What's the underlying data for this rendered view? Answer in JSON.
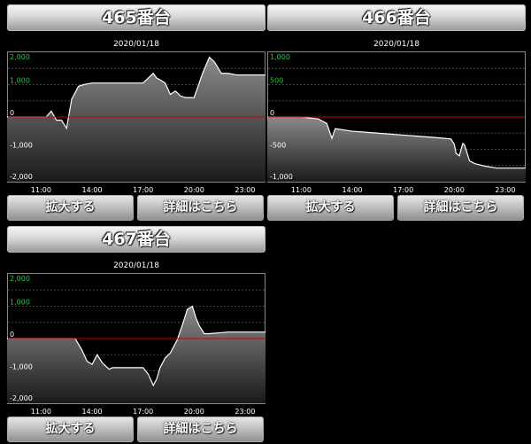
{
  "buttons": {
    "zoom": "拡大する",
    "detail": "詳細はこちら"
  },
  "colors": {
    "zero_line": "#cc0000",
    "positive_tick": "#22cc44",
    "axis_text": "#ffffff"
  },
  "chart_data": [
    {
      "type": "area",
      "title": "465番台",
      "date": "2020/01/18",
      "ylim": [
        -2000,
        2000
      ],
      "yticks": [
        {
          "v": 2000,
          "label": "2,000"
        },
        {
          "v": 1000,
          "label": "1,000"
        },
        {
          "v": 0,
          "label": "0"
        },
        {
          "v": -1000,
          "label": "-1,000"
        },
        {
          "v": -2000,
          "label": "-2,000"
        }
      ],
      "xlim": [
        9.0,
        24.2
      ],
      "xticks": [
        {
          "v": 11,
          "label": "11:00"
        },
        {
          "v": 14,
          "label": "14:00"
        },
        {
          "v": 17,
          "label": "17:00"
        },
        {
          "v": 20,
          "label": "20:00"
        },
        {
          "v": 23,
          "label": "23:00"
        }
      ],
      "x": [
        9.0,
        11.3,
        11.6,
        11.9,
        12.2,
        12.5,
        12.8,
        13.2,
        13.5,
        14.0,
        15.0,
        16.0,
        17.0,
        17.6,
        17.8,
        18.0,
        18.3,
        18.6,
        18.9,
        19.2,
        19.5,
        20.0,
        20.5,
        20.9,
        21.2,
        21.6,
        22.0,
        22.5,
        24.2
      ],
      "values": [
        0,
        0,
        180,
        -100,
        -100,
        -350,
        550,
        950,
        1000,
        1050,
        1050,
        1050,
        1050,
        1350,
        1200,
        1150,
        1050,
        700,
        800,
        650,
        600,
        600,
        1350,
        1850,
        1700,
        1350,
        1350,
        1300,
        1300
      ]
    },
    {
      "type": "area",
      "title": "466番台",
      "date": "2020/01/18",
      "ylim": [
        -1000,
        1000
      ],
      "yticks": [
        {
          "v": 1000,
          "label": "1,000"
        },
        {
          "v": 500,
          "label": "500"
        },
        {
          "v": 0,
          "label": "0"
        },
        {
          "v": -500,
          "label": "-500"
        },
        {
          "v": -1000,
          "label": "-1,000"
        }
      ],
      "xlim": [
        9.0,
        24.2
      ],
      "xticks": [
        {
          "v": 11,
          "label": "11:00"
        },
        {
          "v": 14,
          "label": "14:00"
        },
        {
          "v": 17,
          "label": "17:00"
        },
        {
          "v": 20,
          "label": "20:00"
        },
        {
          "v": 23,
          "label": "23:00"
        }
      ],
      "x": [
        9.0,
        11.0,
        12.0,
        12.5,
        12.8,
        13.0,
        14.0,
        15.0,
        16.0,
        17.0,
        18.0,
        19.0,
        19.8,
        20.0,
        20.1,
        20.3,
        20.4,
        20.5,
        20.6,
        20.9,
        21.2,
        21.8,
        22.5,
        23.4,
        24.2
      ],
      "values": [
        0,
        0,
        -30,
        -100,
        -330,
        -180,
        -220,
        -240,
        -260,
        -280,
        -300,
        -320,
        -340,
        -420,
        -560,
        -600,
        -500,
        -410,
        -430,
        -680,
        -720,
        -760,
        -790,
        -790,
        -790
      ]
    },
    {
      "type": "area",
      "title": "467番台",
      "date": "2020/01/18",
      "ylim": [
        -2000,
        2000
      ],
      "yticks": [
        {
          "v": 2000,
          "label": "2,000"
        },
        {
          "v": 1000,
          "label": "1,000"
        },
        {
          "v": 0,
          "label": "0"
        },
        {
          "v": -1000,
          "label": "-1,000"
        },
        {
          "v": -2000,
          "label": "-2,000"
        }
      ],
      "xlim": [
        9.0,
        24.2
      ],
      "xticks": [
        {
          "v": 11,
          "label": "11:00"
        },
        {
          "v": 14,
          "label": "14:00"
        },
        {
          "v": 17,
          "label": "17:00"
        },
        {
          "v": 20,
          "label": "20:00"
        },
        {
          "v": 23,
          "label": "23:00"
        }
      ],
      "x": [
        9.0,
        13.0,
        13.4,
        13.7,
        14.0,
        14.3,
        14.6,
        15.0,
        15.2,
        15.5,
        16.0,
        16.5,
        17.0,
        17.3,
        17.6,
        17.8,
        18.0,
        18.3,
        18.6,
        19.0,
        19.3,
        19.6,
        19.9,
        20.1,
        20.3,
        20.6,
        20.9,
        22.0,
        24.2
      ],
      "values": [
        0,
        0,
        -350,
        -700,
        -800,
        -500,
        -750,
        -950,
        -900,
        -900,
        -900,
        -900,
        -900,
        -1100,
        -1450,
        -1250,
        -900,
        -600,
        -450,
        -50,
        400,
        900,
        1000,
        650,
        400,
        150,
        150,
        200,
        200
      ]
    }
  ]
}
